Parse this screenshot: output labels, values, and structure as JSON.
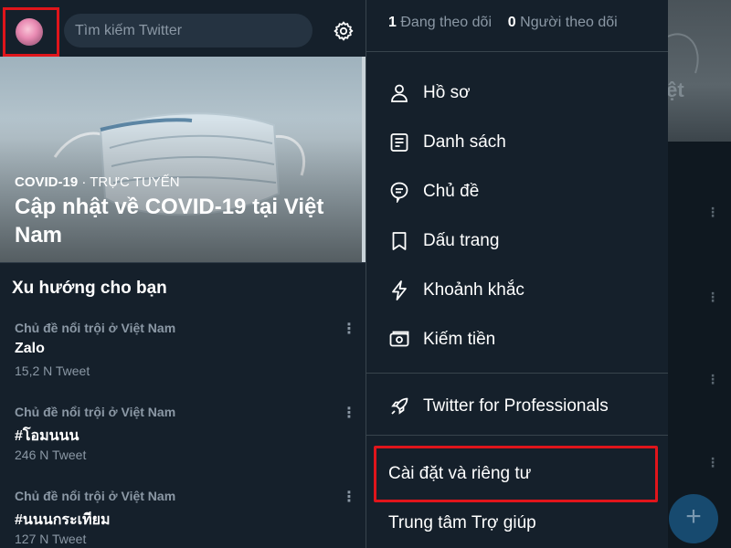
{
  "search": {
    "placeholder": "Tìm kiếm Twitter"
  },
  "hero": {
    "category": "COVID-19",
    "separator": " · ",
    "status": "TRỰC TUYẾN",
    "title": "Cập nhật về COVID-19 tại Việt Nam"
  },
  "trends": {
    "title": "Xu hướng cho bạn",
    "items": [
      {
        "context": "Chủ đề nổi trội ở Việt Nam",
        "name": "Zalo",
        "count": "15,2 N Tweet"
      },
      {
        "context": "Chủ đề nổi trội ở Việt Nam",
        "name": "#โอมนนน",
        "count": "246 N Tweet"
      },
      {
        "context": "Chủ đề nổi trội ở Việt Nam",
        "name": "#นนนกระเทียม",
        "count": "127 N Tweet"
      }
    ]
  },
  "drawer": {
    "following_count": "1",
    "following_label": "Đang theo dõi",
    "followers_count": "0",
    "followers_label": "Người theo dõi",
    "menu": [
      {
        "label": "Hồ sơ",
        "icon": "profile-icon"
      },
      {
        "label": "Danh sách",
        "icon": "lists-icon"
      },
      {
        "label": "Chủ đề",
        "icon": "topics-icon"
      },
      {
        "label": "Dấu trang",
        "icon": "bookmark-icon"
      },
      {
        "label": "Khoảnh khắc",
        "icon": "lightning-icon"
      },
      {
        "label": "Kiếm tiền",
        "icon": "money-icon"
      }
    ],
    "professional": {
      "label": "Twitter for Professionals",
      "icon": "rocket-icon"
    },
    "settings_label": "Cài đặt và riêng tư",
    "help_label": "Trung tâm Trợ giúp"
  },
  "right": {
    "hero_fragment": "iệt"
  },
  "fab": {
    "label": "+"
  },
  "colors": {
    "background": "#15202b",
    "secondary_text": "#8b98a5",
    "divider": "#38444d",
    "highlight": "#e0151b",
    "fab": "#174a6f"
  }
}
